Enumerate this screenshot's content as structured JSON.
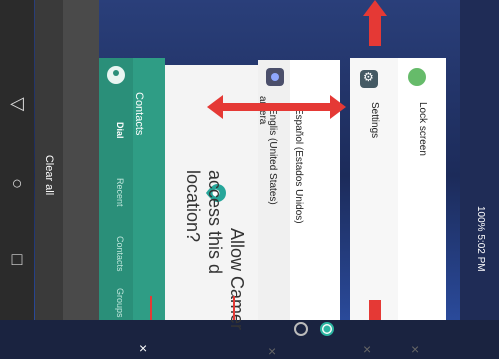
{
  "nav": {
    "back_label": "◁",
    "home_label": "○",
    "recent_label": "□",
    "clear_all": "Clear all"
  },
  "cards": {
    "contacts": {
      "title": "Contacts",
      "tabs": [
        "Dial",
        "Recent",
        "Contacts",
        "Groups"
      ],
      "close": "×"
    },
    "permission": {
      "line1": "Allow Camer",
      "line2": "access this d",
      "line3": "location?"
    },
    "language": {
      "title": "amera",
      "option_en": "Englis (United States)",
      "option_es": "Español (Estados Unidos)",
      "close": "×"
    },
    "settings": {
      "title": "Settings",
      "close": "×"
    },
    "lock": {
      "title": "Lock screen",
      "close": "×"
    }
  },
  "status": {
    "text": "100% 5:02 PM"
  },
  "colors": {
    "accent": "#2f9d85",
    "arrow": "#e53935"
  }
}
